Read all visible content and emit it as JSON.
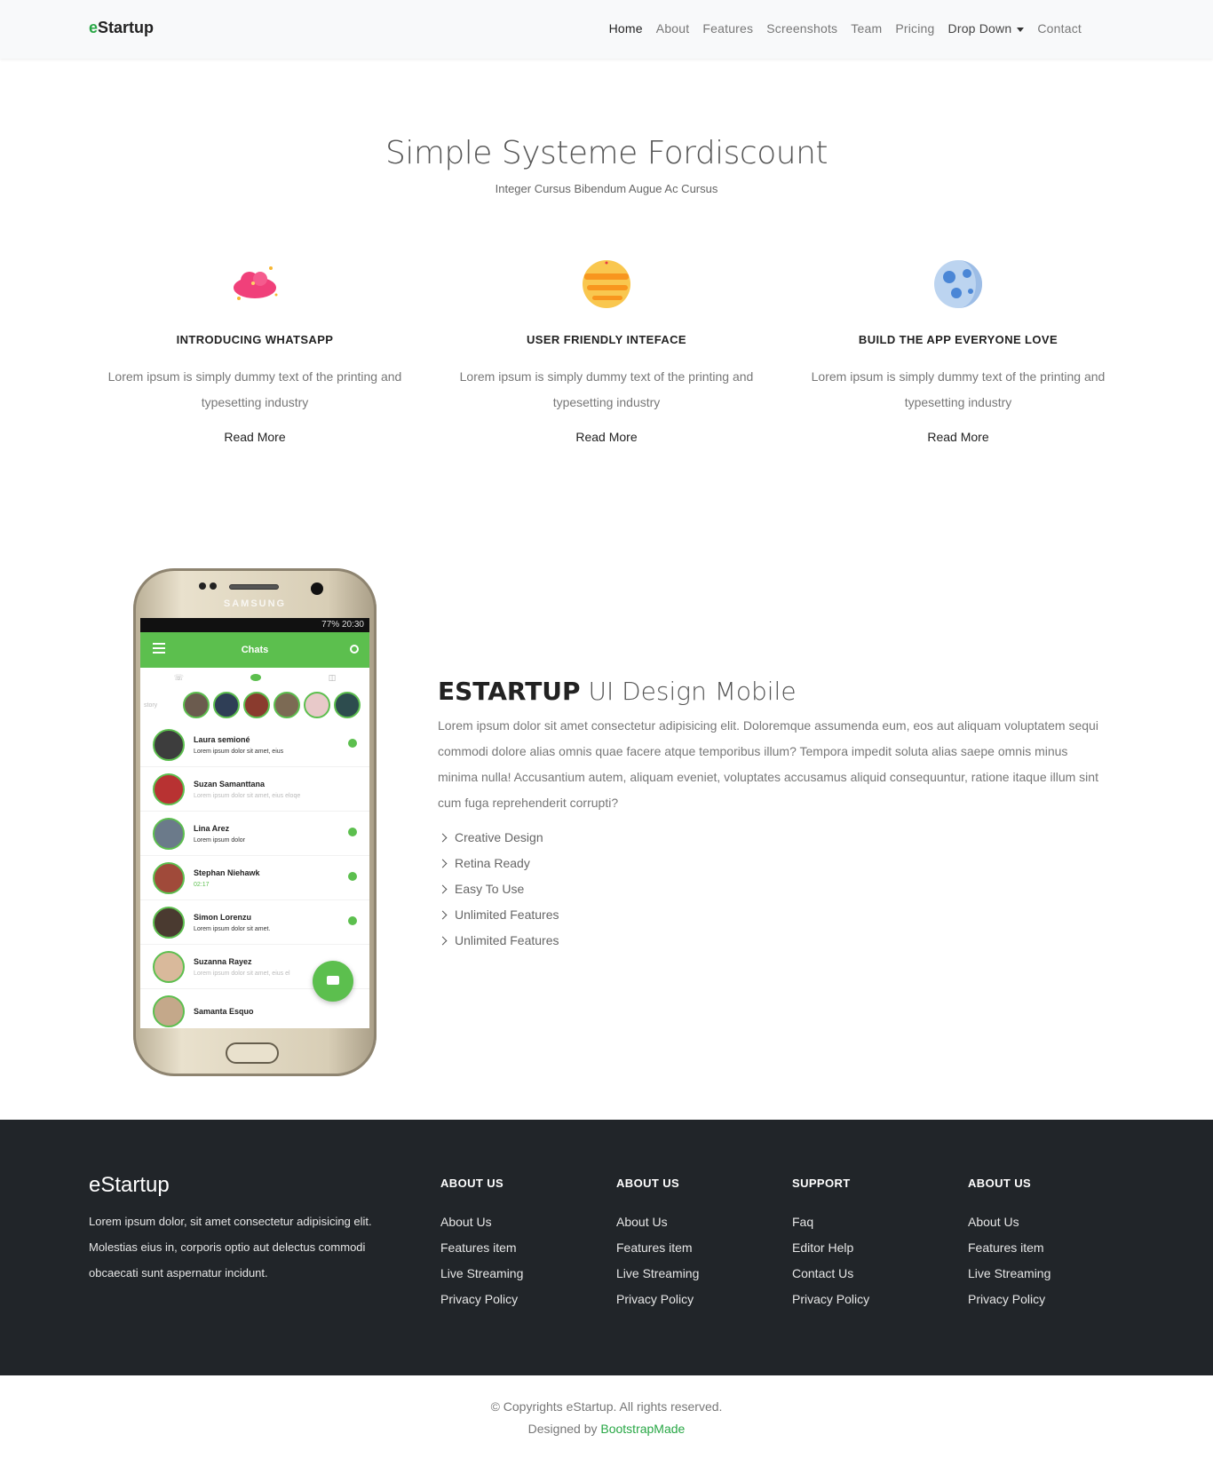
{
  "navbar": {
    "brand_prefix": "e",
    "brand_rest": "Startup",
    "links": [
      "Home",
      "About",
      "Features",
      "Screenshots",
      "Team",
      "Pricing",
      "Drop Down",
      "Contact"
    ]
  },
  "hero": {
    "title": "Simple Systeme Fordiscount",
    "subtitle": "Integer Cursus Bibendum Augue Ac Cursus"
  },
  "features": [
    {
      "icon": "cloud-icon",
      "title": "INTRODUCING WHATSAPP",
      "text": "Lorem ipsum is simply dummy text of the printing and typesetting industry",
      "link": "Read More"
    },
    {
      "icon": "planet-icon",
      "title": "USER FRIENDLY INTEFACE",
      "text": "Lorem ipsum is simply dummy text of the printing and typesetting industry",
      "link": "Read More"
    },
    {
      "icon": "moon-icon",
      "title": "BUILD THE APP EVERYONE LOVE",
      "text": "Lorem ipsum is simply dummy text of the printing and typesetting industry",
      "link": "Read More"
    }
  ],
  "phone": {
    "brand": "SAMSUNG",
    "status": "77% 20:30",
    "app_title": "Chats",
    "stories_label": "story",
    "chats": [
      {
        "name": "Laura semioné",
        "msg": "Lorem ipsum dolor sit amet, eius"
      },
      {
        "name": "Suzan Samanttana",
        "msg": "Lorem ipsum dolor sit amet, eius eloqe"
      },
      {
        "name": "Lina Arez",
        "msg": "Lorem ipsum dolor"
      },
      {
        "name": "Stephan Niehawk",
        "msg": "02:17"
      },
      {
        "name": "Simon Lorenzu",
        "msg": "Lorem ipsum dolor sit amet."
      },
      {
        "name": "Suzanna Rayez",
        "msg": "Lorem ipsum dolor sit amet, eius el"
      },
      {
        "name": "Samanta Esquo",
        "msg": ""
      }
    ]
  },
  "about": {
    "title_bold": "ESTARTUP",
    "title_rest": " UI Design Mobile",
    "text": "Lorem ipsum dolor sit amet consectetur adipisicing elit. Doloremque assumenda eum, eos aut aliquam voluptatem sequi commodi dolore alias omnis quae facere atque temporibus illum? Tempora impedit soluta alias saepe omnis minus minima nulla! Accusantium autem, aliquam eveniet, voluptates accusamus aliquid consequuntur, ratione itaque illum sint cum fuga reprehenderit corrupti?",
    "list": [
      "Creative Design",
      "Retina Ready",
      "Easy To Use",
      "Unlimited Features",
      "Unlimited Features"
    ]
  },
  "footer": {
    "brand": "eStartup",
    "desc": "Lorem ipsum dolor, sit amet consectetur adipisicing elit. Molestias eius in, corporis optio aut delectus commodi obcaecati sunt aspernatur incidunt.",
    "columns": [
      {
        "title": "ABOUT US",
        "items": [
          "About Us",
          "Features item",
          "Live Streaming",
          "Privacy Policy"
        ]
      },
      {
        "title": "ABOUT US",
        "items": [
          "About Us",
          "Features item",
          "Live Streaming",
          "Privacy Policy"
        ]
      },
      {
        "title": "SUPPORT",
        "items": [
          "Faq",
          "Editor Help",
          "Contact Us",
          "Privacy Policy"
        ]
      },
      {
        "title": "ABOUT US",
        "items": [
          "About Us",
          "Features item",
          "Live Streaming",
          "Privacy Policy"
        ]
      }
    ]
  },
  "copyright": {
    "line1": "© Copyrights eStartup. All rights reserved.",
    "designed_by": "Designed by ",
    "designer": "BootstrapMade"
  },
  "colors": {
    "accent": "#28a745",
    "chat_green": "#5cbf4e",
    "footer_bg": "#212529"
  }
}
